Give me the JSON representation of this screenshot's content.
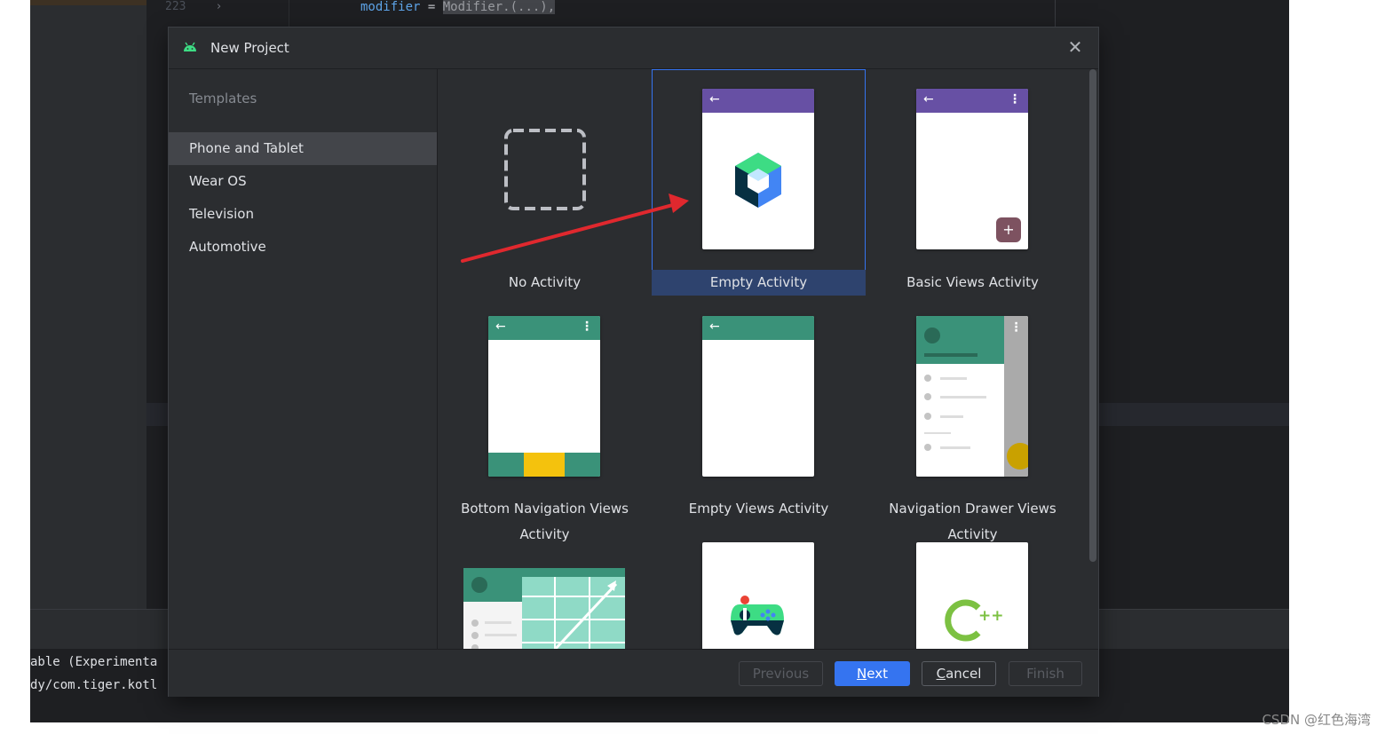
{
  "ide": {
    "gutter_line": "223",
    "code_line_keyword": "modifier",
    "code_line_op": " = ",
    "code_line_value": "Modifier.(...),",
    "console_lines": [
      "able (Experimenta",
      "dy/com.tiger.kotl"
    ]
  },
  "dialog": {
    "title": "New Project",
    "close_symbol": "✕",
    "sidebar": {
      "header": "Templates",
      "items": [
        {
          "label": "Phone and Tablet",
          "selected": true
        },
        {
          "label": "Wear OS",
          "selected": false
        },
        {
          "label": "Television",
          "selected": false
        },
        {
          "label": "Automotive",
          "selected": false
        }
      ]
    },
    "templates": [
      {
        "label": "No Activity",
        "selected": false
      },
      {
        "label": "Empty Activity",
        "selected": true
      },
      {
        "label": "Basic Views Activity",
        "selected": false
      },
      {
        "label": "Bottom Navigation Views Activity",
        "selected": false
      },
      {
        "label": "Empty Views Activity",
        "selected": false
      },
      {
        "label": "Navigation Drawer Views Activity",
        "selected": false
      }
    ],
    "footer": {
      "previous": "Previous",
      "next": "Next",
      "cancel": "Cancel",
      "finish": "Finish"
    }
  },
  "icons": {
    "back": "←",
    "overflow_menu": "⋮",
    "fab_plus": "+",
    "cpp": "++"
  },
  "colors": {
    "accent": "#3574f0",
    "purple_appbar": "#6750a4",
    "teal_appbar": "#3a9279",
    "annotation_arrow": "#e0282e"
  },
  "watermark": "CSDN @红色海湾"
}
